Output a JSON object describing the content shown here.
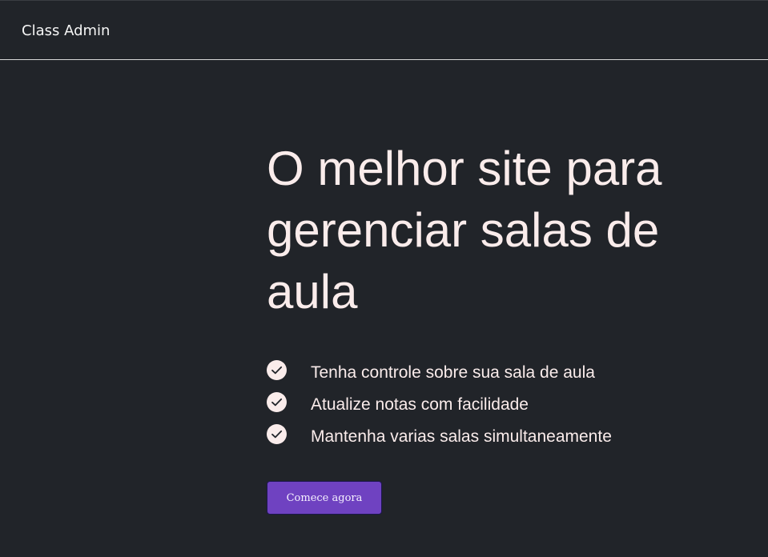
{
  "navbar": {
    "brand": "Class Admin"
  },
  "hero": {
    "title": "O melhor site para gerenciar salas de aula",
    "features": [
      {
        "icon": "check-circle-icon",
        "text": "Tenha controle sobre sua sala de aula"
      },
      {
        "icon": "check-circle-icon",
        "text": "Atualize notas com facilidade"
      },
      {
        "icon": "check-circle-icon",
        "text": "Mantenha varias salas simultaneamente"
      }
    ],
    "cta_label": "Comece agora"
  },
  "colors": {
    "background": "#212429",
    "text": "#faeceb",
    "accent": "#6f42c1"
  }
}
